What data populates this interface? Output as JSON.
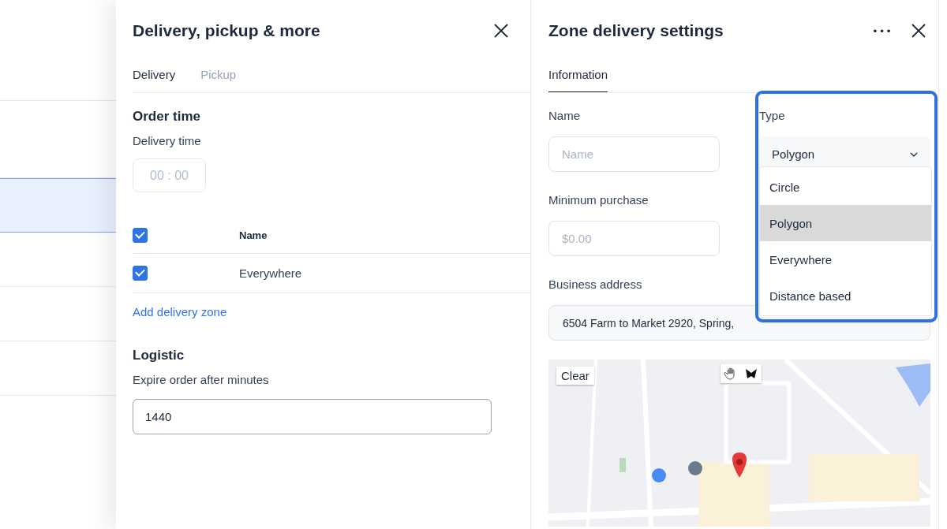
{
  "background_rows": [
    {
      "selected": false
    },
    {
      "selected": true
    },
    {
      "selected": false
    },
    {
      "selected": false
    },
    {
      "selected": false
    }
  ],
  "delivery_panel": {
    "title": "Delivery, pickup & more",
    "tabs": [
      {
        "label": "Delivery",
        "selected": true
      },
      {
        "label": "Pickup",
        "selected": false
      }
    ],
    "order_time": {
      "heading": "Order time",
      "label": "Delivery time",
      "placeholder": "00 : 00"
    },
    "zones_table": {
      "header": {
        "checked": true,
        "column": "Name"
      },
      "rows": [
        {
          "checked": true,
          "name": "Everywhere"
        }
      ]
    },
    "add_zone_link": "Add delivery zone",
    "logistic": {
      "heading": "Logistic",
      "label": "Expire order after minutes",
      "value": "1440"
    }
  },
  "zone_panel": {
    "title": "Zone delivery settings",
    "more_icon": "•••",
    "tabs": [
      {
        "label": "Information",
        "selected": true
      }
    ],
    "name": {
      "label": "Name",
      "placeholder": "Name"
    },
    "type": {
      "label": "Type",
      "value": "Polygon",
      "expanded": true,
      "options": [
        {
          "label": "Circle",
          "selected": false
        },
        {
          "label": "Polygon",
          "selected": true
        },
        {
          "label": "Everywhere",
          "selected": false
        },
        {
          "label": "Distance based",
          "selected": false
        }
      ]
    },
    "minimum_purchase": {
      "label": "Minimum purchase",
      "placeholder": "$0.00"
    },
    "business_address": {
      "label": "Business address",
      "value": "6504 Farm to Market 2920, Spring,"
    },
    "map": {
      "kind": "picture",
      "clear_button": "Clear"
    }
  }
}
